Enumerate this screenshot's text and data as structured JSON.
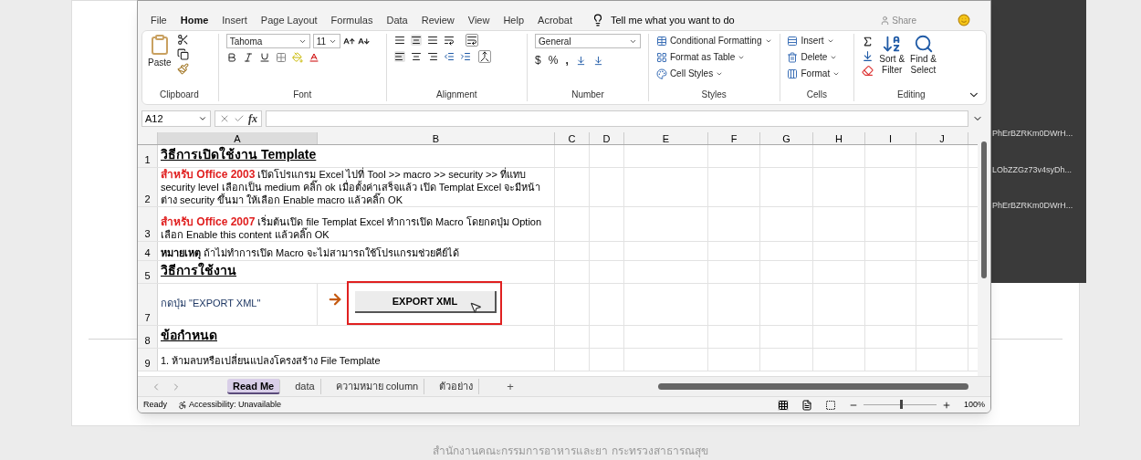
{
  "menu_tabs": [
    {
      "label": "File",
      "selected": false
    },
    {
      "label": "Home",
      "selected": true
    },
    {
      "label": "Insert",
      "selected": false
    },
    {
      "label": "Page Layout",
      "selected": false
    },
    {
      "label": "Formulas",
      "selected": false
    },
    {
      "label": "Data",
      "selected": false
    },
    {
      "label": "Review",
      "selected": false
    },
    {
      "label": "View",
      "selected": false
    },
    {
      "label": "Help",
      "selected": false
    },
    {
      "label": "Acrobat",
      "selected": false
    }
  ],
  "tell_me": "Tell me what you want to do",
  "share": "Share",
  "ribbon": {
    "clipboard": {
      "paste": "Paste",
      "group": "Clipboard"
    },
    "font": {
      "name": "Tahoma",
      "size": "11",
      "group": "Font"
    },
    "alignment": {
      "group": "Alignment"
    },
    "number": {
      "format": "General",
      "currency": "$",
      "percent": "%",
      "comma": ",",
      "group": "Number"
    },
    "styles": {
      "items": [
        "Conditional Formatting",
        "Format as Table",
        "Cell Styles"
      ],
      "group": "Styles"
    },
    "cells": {
      "items": [
        "Insert",
        "Delete",
        "Format"
      ],
      "group": "Cells"
    },
    "editing": {
      "sort": [
        "Sort &",
        "Filter"
      ],
      "find": [
        "Find &",
        "Select"
      ],
      "group": "Editing"
    }
  },
  "name_box": "A12",
  "fx": "fx",
  "columns": [
    "A",
    "B",
    "C",
    "D",
    "E",
    "F",
    "G",
    "H",
    "I",
    "J"
  ],
  "rows": [
    {
      "number": "1",
      "kind": "heading",
      "text": "วิธีการเปิดใช้งาน Template"
    },
    {
      "number": "2",
      "kind": "office",
      "lead": "สำหรับ Office 2003",
      "text": "เปิดโปรแกรม Excel ไปที่ Tool >> macro >> security >> ที่แทบ security level เลือกเป็น medium คลิ๊ก ok เมื่อตั้งค่าเสร็จแล้ว เปิด Templat Excel จะมีหน้าต่าง  security ขึ้นมา ให้เลือก Enable macro แล้วคลิ๊ก OK"
    },
    {
      "number": "3",
      "kind": "office",
      "lead": "สำหรับ Office 2007",
      "text": "เริ่มต้นเปิด file Templat Excel ทำการเปิด Macro โดยกดปุ่ม Option เลือก Enable this content แล้วคลิ๊ก OK"
    },
    {
      "number": "4",
      "kind": "note",
      "text": "**หมายเหตุ**  ถ้าไม่ทำการเปิด Macro จะไม่สามารถใช้โปรแกรมช่วยคีย์ได้"
    },
    {
      "number": "5",
      "kind": "heading",
      "text": "วิธีการใช้งาน"
    },
    {
      "number": "7",
      "kind": "action",
      "text": "กดปุ่ม \"EXPORT XML\"",
      "button": "EXPORT XML"
    },
    {
      "number": "8",
      "kind": "heading",
      "text": "ข้อกำหนด"
    },
    {
      "number": "9",
      "kind": "plain",
      "text": "1. ห้ามลบหรือเปลี่ยนแปลงโครงสร้าง File Template"
    }
  ],
  "sheet_tabs": [
    {
      "label": "Read Me",
      "selected": true
    },
    {
      "label": "data",
      "selected": false
    },
    {
      "label": "ความหมาย column",
      "selected": false
    },
    {
      "label": "ตัวอย่าง",
      "selected": false
    }
  ],
  "add_sheet": "+",
  "status": {
    "ready": "Ready",
    "accessibility": "Accessibility: Unavailable",
    "zoom": "100%",
    "level": 0.5
  },
  "side_panel": [
    "PhErBZRKm0DWrH...",
    "LObZZGz73v4syDh...",
    "PhErBZRKm0DWrH..."
  ],
  "footer": "สำนักงานคณะกรรมการอาหารและยา กระทรวงสาธารณสุข"
}
